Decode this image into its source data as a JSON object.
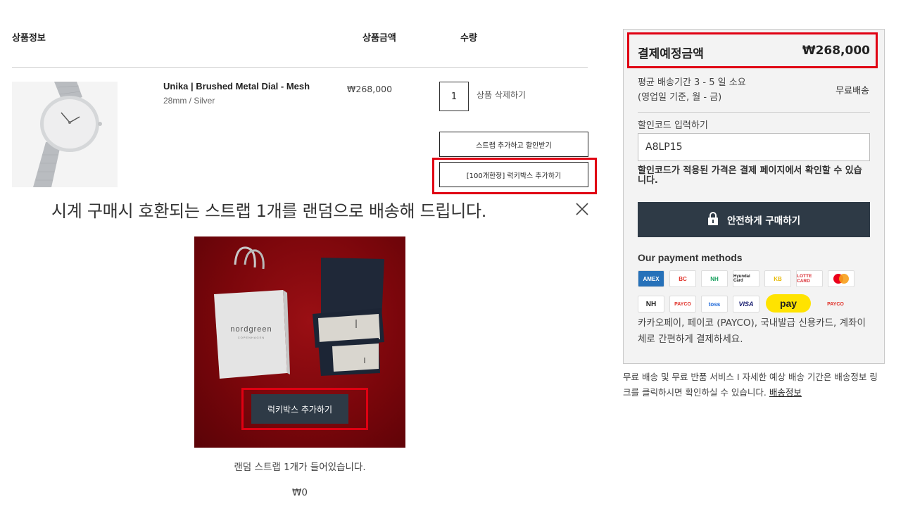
{
  "cart_header": {
    "product_info": "상품정보",
    "price": "상품금액",
    "quantity": "수량"
  },
  "product": {
    "name": "Unika | Brushed Metal Dial - Mesh",
    "variant": "28mm / Silver",
    "price": "₩268,000",
    "quantity": "1",
    "remove_label": "상품 삭제하기",
    "strap_button": "스트랩 추가하고 할인받기",
    "lucky_box_button": "[100개한정] 럭키박스 추가하기"
  },
  "promo": {
    "title": "시계 구매시 호환되는 스트랩 1개를 랜덤으로 배송해 드립니다.",
    "image_brand": "nordgreen",
    "image_brand_sub": "COPENHAGEN",
    "add_button": "럭키박스 추가하기",
    "caption": "랜덤 스트랩 1개가 들어있습니다.",
    "price": "₩0"
  },
  "summary": {
    "title": "결제예정금액",
    "total": "₩268,000",
    "shipping_time_line1": "평균 배송기간 3 - 5 일 소요",
    "shipping_time_line2": "(영업일 기준, 월 - 금)",
    "shipping_fee": "무료배송",
    "discount_label": "할인코드 입력하기",
    "discount_value": "A8LP15",
    "discount_note": "할인코드가 적용된 가격은 결제 페이지에서 확인할 수 있습니다.",
    "checkout_button": "안전하게 구매하기",
    "payment_title": "Our payment methods",
    "payment_methods": [
      "AMEX",
      "BC",
      "NH",
      "Hyundai Card",
      "KB",
      "LOTTE CARD",
      "Mastercard",
      "NH",
      "PAYCO",
      "toss",
      "VISA",
      "pay",
      "PAYCO"
    ],
    "payment_desc": "카카오페이, 페이코 (PAYCO), 국내발급 신용카드, 계좌이체로 간편하게 결제하세요."
  },
  "footer": {
    "note": "무료 배송 및 무료 반품 서비스 I 자세한 예상 배송 기간은 배송정보 링크를 클릭하시면 확인하실 수 있습니다.",
    "link": "배송정보"
  },
  "colors": {
    "accent_dark": "#2e3a46",
    "highlight_red": "#e00012",
    "panel_bg": "#f3f3f3"
  }
}
